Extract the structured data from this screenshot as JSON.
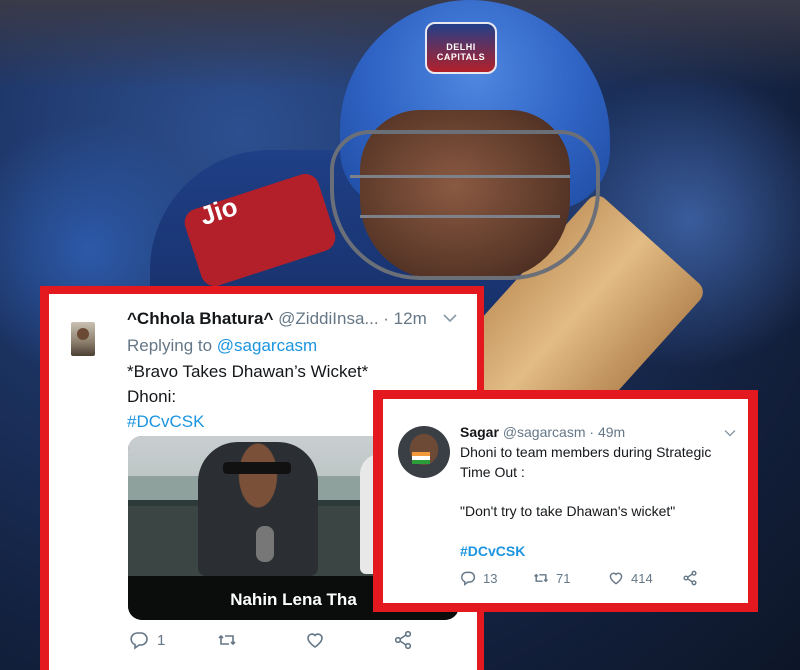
{
  "background": {
    "helmet_badge_text": "DELHI CAPITALS",
    "jersey_text": "Jio"
  },
  "tweet_left": {
    "name": "^Chhola Bhatura^",
    "handle": "@ZiddiInsa...",
    "time": "· 12m",
    "reply_prefix": "Replying to",
    "reply_mention": "@sagarcasm",
    "text_line1": "*Bravo Takes Dhawan’s Wicket*",
    "text_line2": "Dhoni:",
    "hashtag": "#DCvCSK",
    "media_caption": "Nahin Lena Tha",
    "reply_count": "1",
    "retweet_count": "",
    "like_count": ""
  },
  "tweet_right": {
    "name": "Sagar",
    "handle": "@sagarcasm",
    "time": "· 49m",
    "text_line1": "Dhoni to team members during Strategic",
    "text_line2": "Time Out :",
    "quote": "\"Don't try to take Dhawan's wicket\"",
    "hashtag": "#DCvCSK",
    "reply_count": "13",
    "retweet_count": "71",
    "like_count": "414"
  },
  "colors": {
    "frame_red": "#e4191f",
    "link_blue": "#1b95e0",
    "muted_gray": "#657786"
  }
}
